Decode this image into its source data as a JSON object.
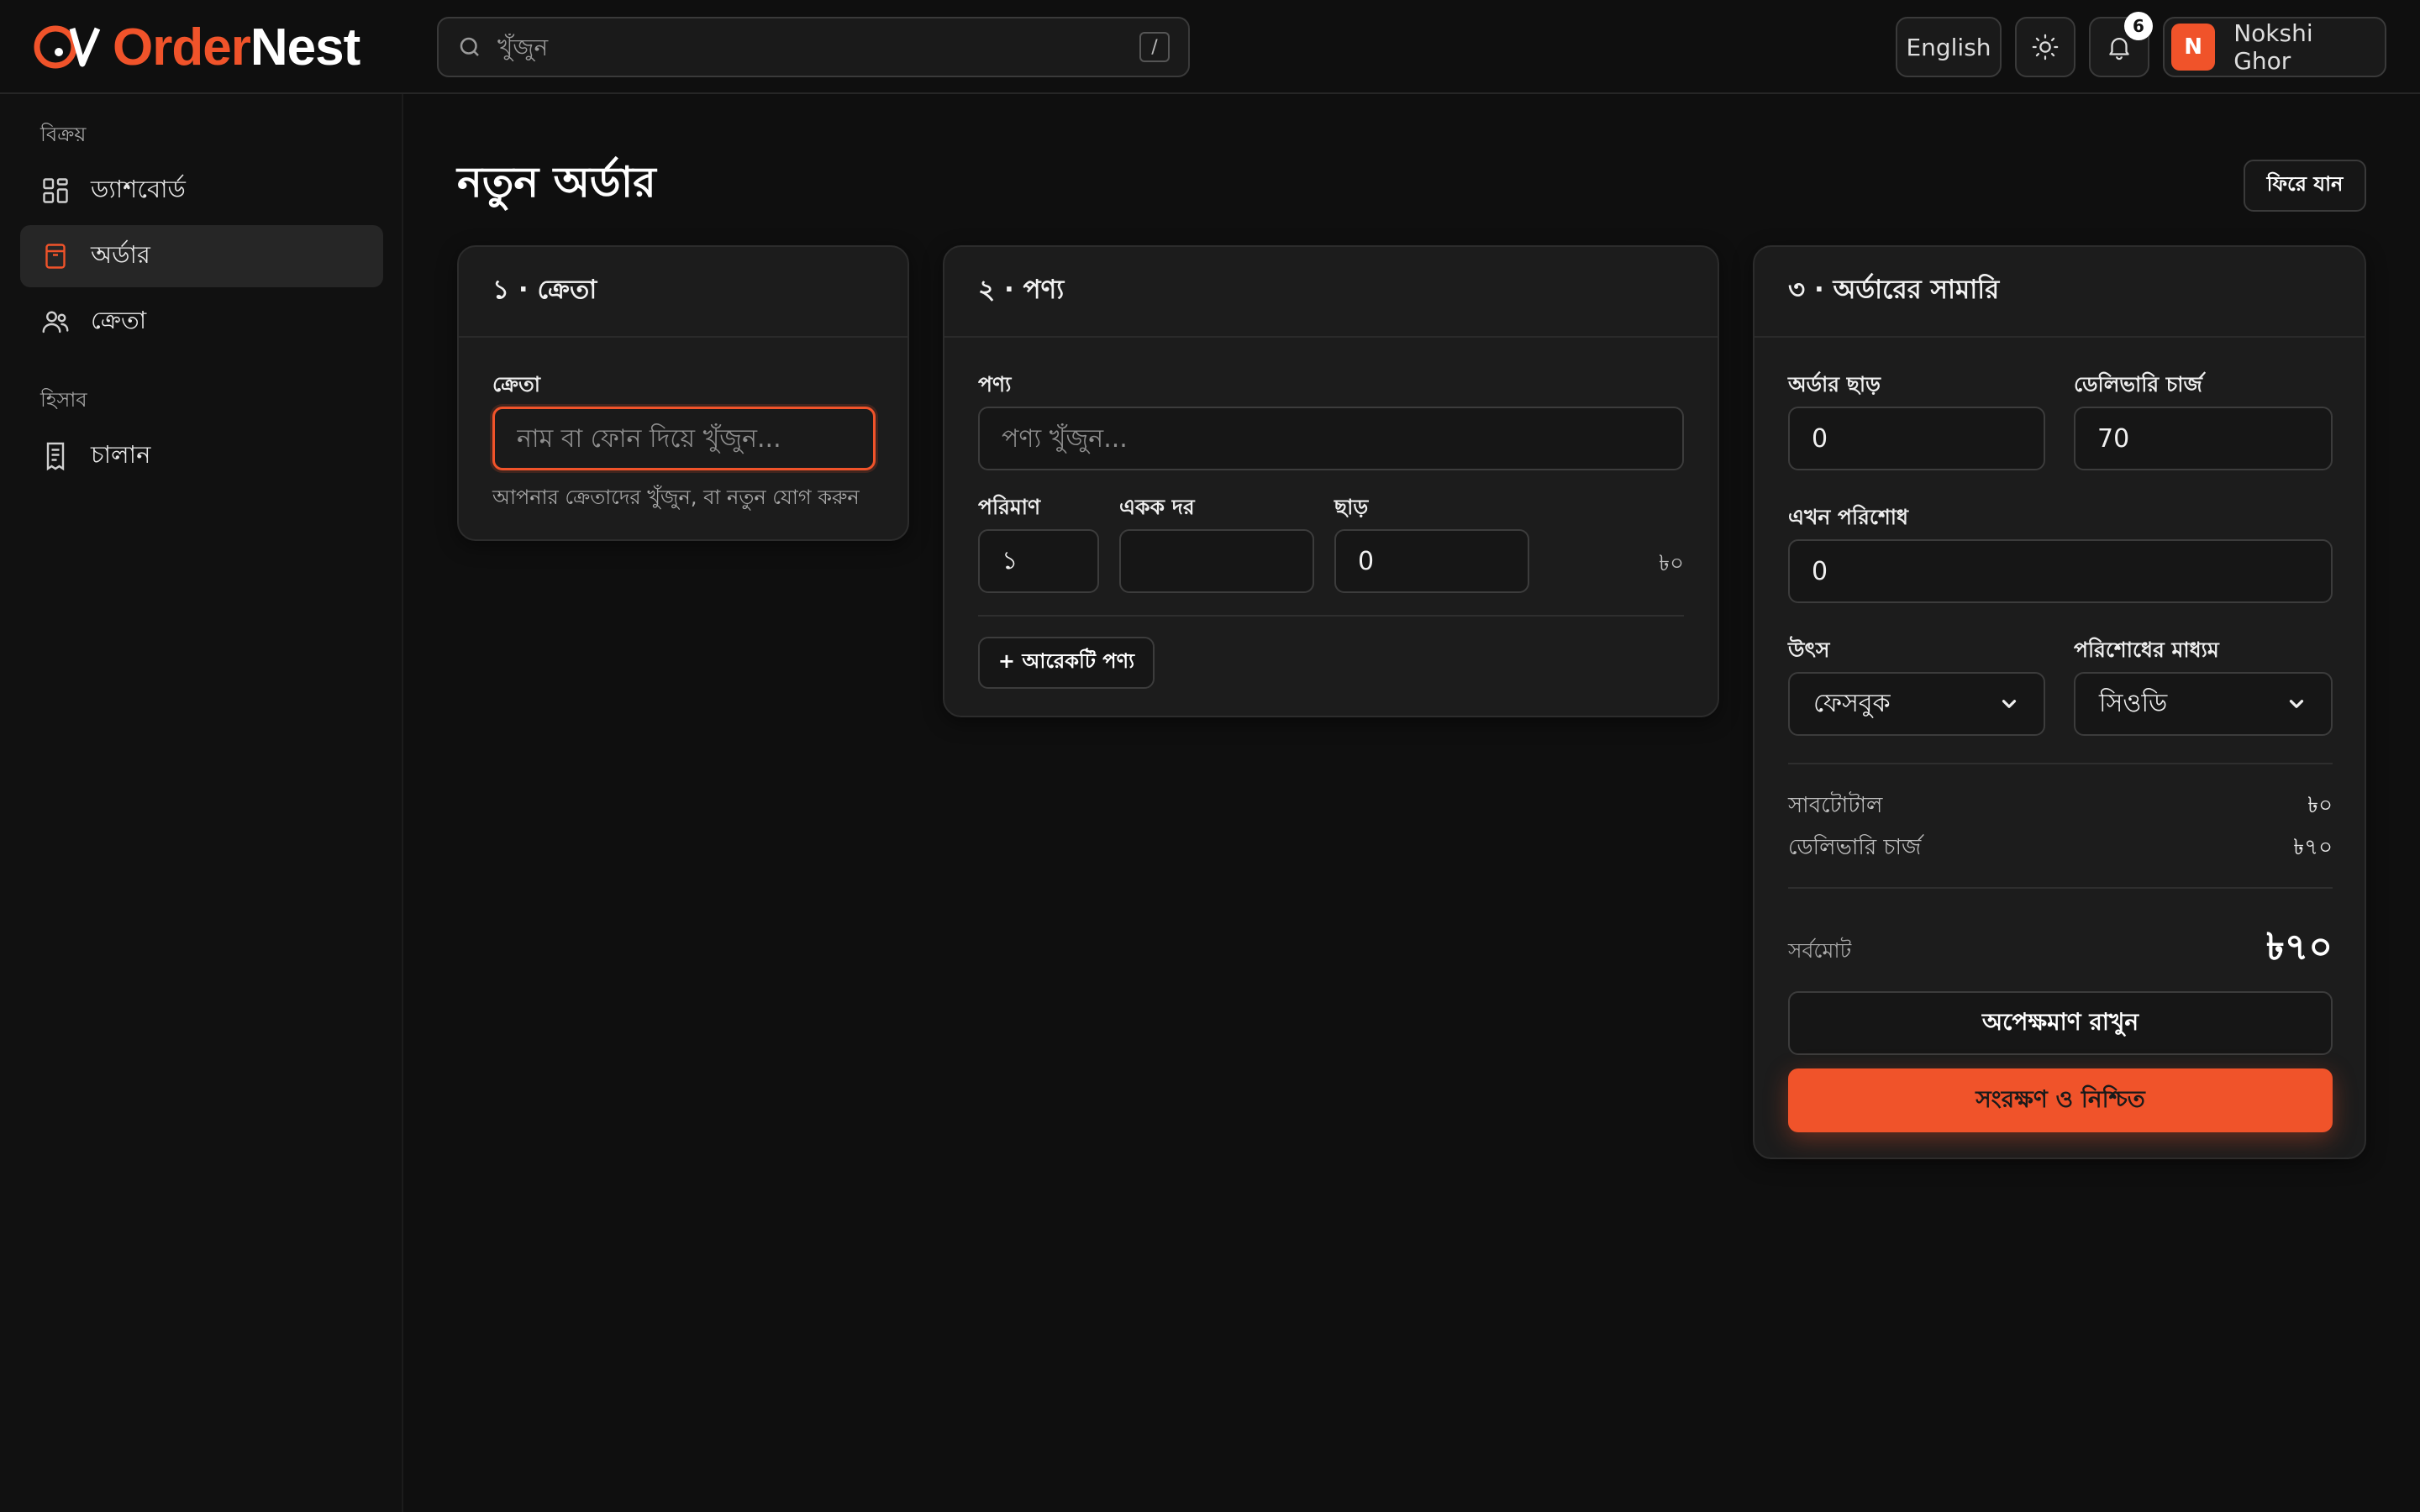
{
  "app": {
    "name_part1": "Order",
    "name_part2": "Nest",
    "brand_color": "#f0532a"
  },
  "header": {
    "search_placeholder": "খুঁজুন",
    "search_shortcut": "/",
    "language_button": "English",
    "theme_icon": "sun-icon",
    "notification_icon": "bell-icon",
    "notification_count": "6",
    "user_initial": "N",
    "user_name": "Nokshi Ghor"
  },
  "sidebar": {
    "sections": [
      {
        "title": "বিক্রয়",
        "items": [
          {
            "label": "ড্যাশবোর্ড",
            "icon": "dashboard-grid-icon",
            "active": false
          },
          {
            "label": "অর্ডার",
            "icon": "order-box-icon",
            "active": true
          },
          {
            "label": "ক্রেতা",
            "icon": "users-icon",
            "active": false
          }
        ]
      },
      {
        "title": "হিসাব",
        "items": [
          {
            "label": "চালান",
            "icon": "receipt-icon",
            "active": false
          }
        ]
      }
    ]
  },
  "page": {
    "title": "নতুন অর্ডার",
    "back_button": "ফিরে যান"
  },
  "customer_card": {
    "heading": "১ · ক্রেতা",
    "field_label": "ক্রেতা",
    "field_placeholder": "নাম বা ফোন দিয়ে খুঁজুন...",
    "field_value": "",
    "hint": "আপনার ক্রেতাদের খুঁজুন, বা নতুন যোগ করুন"
  },
  "products_card": {
    "heading": "২ · পণ্য",
    "product_label": "পণ্য",
    "product_placeholder": "পণ্য খুঁজুন...",
    "quantity_label": "পরিমাণ",
    "quantity_value": "১",
    "unit_price_label": "একক দর",
    "unit_price_value": "",
    "discount_label": "ছাড়",
    "discount_value": "0",
    "line_total": "৳০",
    "add_button": "+ আরেকটি পণ্য"
  },
  "summary_card": {
    "heading": "৩ · অর্ডারের সামারি",
    "order_discount_label": "অর্ডার ছাড়",
    "order_discount_value": "0",
    "delivery_charge_label": "ডেলিভারি চার্জ",
    "delivery_charge_value": "70",
    "pay_now_label": "এখন পরিশোধ",
    "pay_now_value": "0",
    "source_label": "উৎস",
    "source_selected": "ফেসবুক",
    "payment_method_label": "পরিশোধের মাধ্যম",
    "payment_method_selected": "সিওডি",
    "subtotal_label": "সাবটোটাল",
    "subtotal_value": "৳০",
    "delivery_label": "ডেলিভারি চার্জ",
    "delivery_value": "৳৭০",
    "grand_total_label": "সর্বমোট",
    "grand_total_value": "৳৭০",
    "hold_button": "অপেক্ষমাণ রাখুন",
    "confirm_button": "সংরক্ষণ ও নিশ্চিত"
  }
}
